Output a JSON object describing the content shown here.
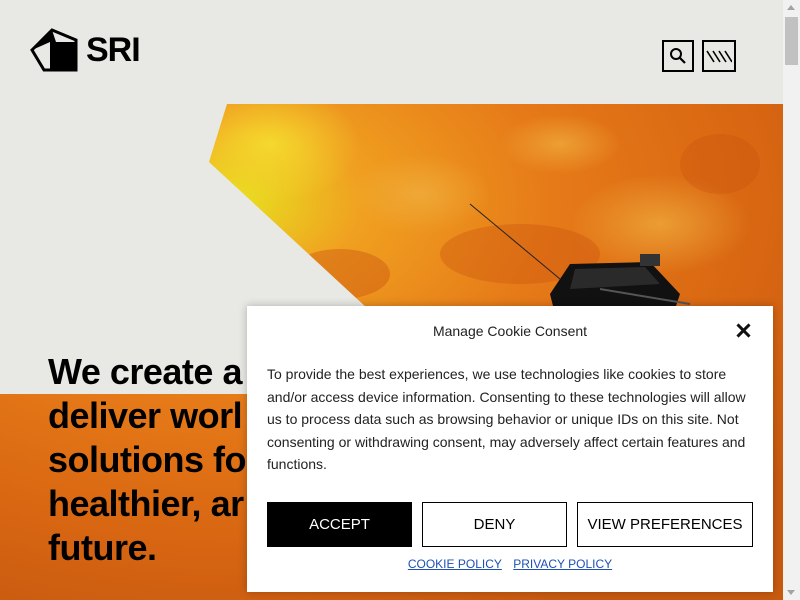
{
  "header": {
    "logo_text": "SRI",
    "search_icon": "search-icon",
    "menu_icon": "slanted-lines-menu-icon"
  },
  "hero": {
    "headline": "We create a\ndeliver worl\nsolutions fo\nhealthier, ar\nfuture.",
    "image": "sun-surface-with-solar-probe"
  },
  "cookie": {
    "title": "Manage Cookie Consent",
    "body": "To provide the best experiences, we use technologies like cookies to store and/or access device information. Consenting to these technologies will allow us to process data such as browsing behavior or unique IDs on this site. Not consenting or withdrawing consent, may adversely affect certain features and functions.",
    "accept_label": "ACCEPT",
    "deny_label": "DENY",
    "prefs_label": "VIEW PREFERENCES",
    "cookie_policy_label": "COOKIE POLICY",
    "privacy_policy_label": "PRIVACY POLICY",
    "close_icon": "close-icon"
  },
  "colors": {
    "page_bg": "#e8e8e4",
    "accent_black": "#000000",
    "link_blue": "#1e50b4",
    "sun_orange": "#e8731a"
  }
}
